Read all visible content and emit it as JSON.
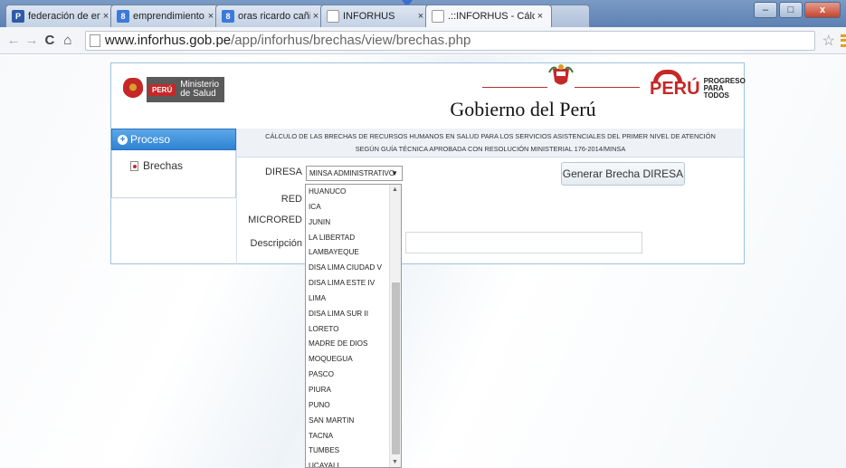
{
  "browser": {
    "tabs": [
      {
        "label": "federación de enfermeras",
        "favicon": "P"
      },
      {
        "label": "emprendimiento ppt - Bu",
        "favicon": "8"
      },
      {
        "label": "oras ricardo cañizares - Bu",
        "favicon": "8"
      },
      {
        "label": "INFORHUS",
        "favicon": ""
      },
      {
        "label": ".::INFORHUS - Cálculo de",
        "favicon": ""
      }
    ],
    "url_host": "www.inforhus.gob.pe",
    "url_path": "/app/inforhus/brechas/view/brechas.php",
    "window_buttons": {
      "minimize": "–",
      "maximize": "□",
      "close": "x"
    },
    "nav": {
      "back": "←",
      "forward": "→",
      "reload": "C",
      "home": "⌂",
      "star": "☆"
    }
  },
  "header": {
    "ministry_flag": "PERÚ",
    "ministry_line1": "Ministerio",
    "ministry_line2": "de Salud",
    "title": "Gobierno del Perú",
    "peru_logo": "PERÚ",
    "slogan_line1": "PROGRESO",
    "slogan_line2": "PARA TODOS"
  },
  "sidebar": {
    "section": "Proceso",
    "items": [
      {
        "label": "Brechas"
      }
    ]
  },
  "caption": {
    "line1": "CÁLCULO DE LAS BRECHAS DE RECURSOS HUMANOS EN SALUD PARA LOS SERVICIOS ASISTENCIALES DEL PRIMER NIVEL DE ATENCIÓN",
    "line2": "SEGÚN GUÍA TÉCNICA APROBADA CON RESOLUCIÓN MINISTERIAL 176-2014/MINSA"
  },
  "form": {
    "diresa_label": "DIRESA",
    "red_label": "RED",
    "microred_label": "MICRORED",
    "descripcion_label": "Descripción",
    "diresa_value": "MINSA ADMINISTRATIVO",
    "generate_button": "Generar Brecha DIRESA"
  },
  "dropdown": {
    "options": [
      "HUANUCO",
      "ICA",
      "JUNIN",
      "LA LIBERTAD",
      "LAMBAYEQUE",
      "DISA LIMA CIUDAD V",
      "DISA LIMA ESTE IV",
      "LIMA",
      "DISA LIMA SUR II",
      "LORETO",
      "MADRE DE DIOS",
      "MOQUEGUA",
      "PASCO",
      "PIURA",
      "PUNO",
      "SAN MARTIN",
      "TACNA",
      "TUMBES",
      "UCAYALI",
      "MINSA ADMINISTRATIVO"
    ],
    "selected": "MINSA ADMINISTRATIVO"
  }
}
